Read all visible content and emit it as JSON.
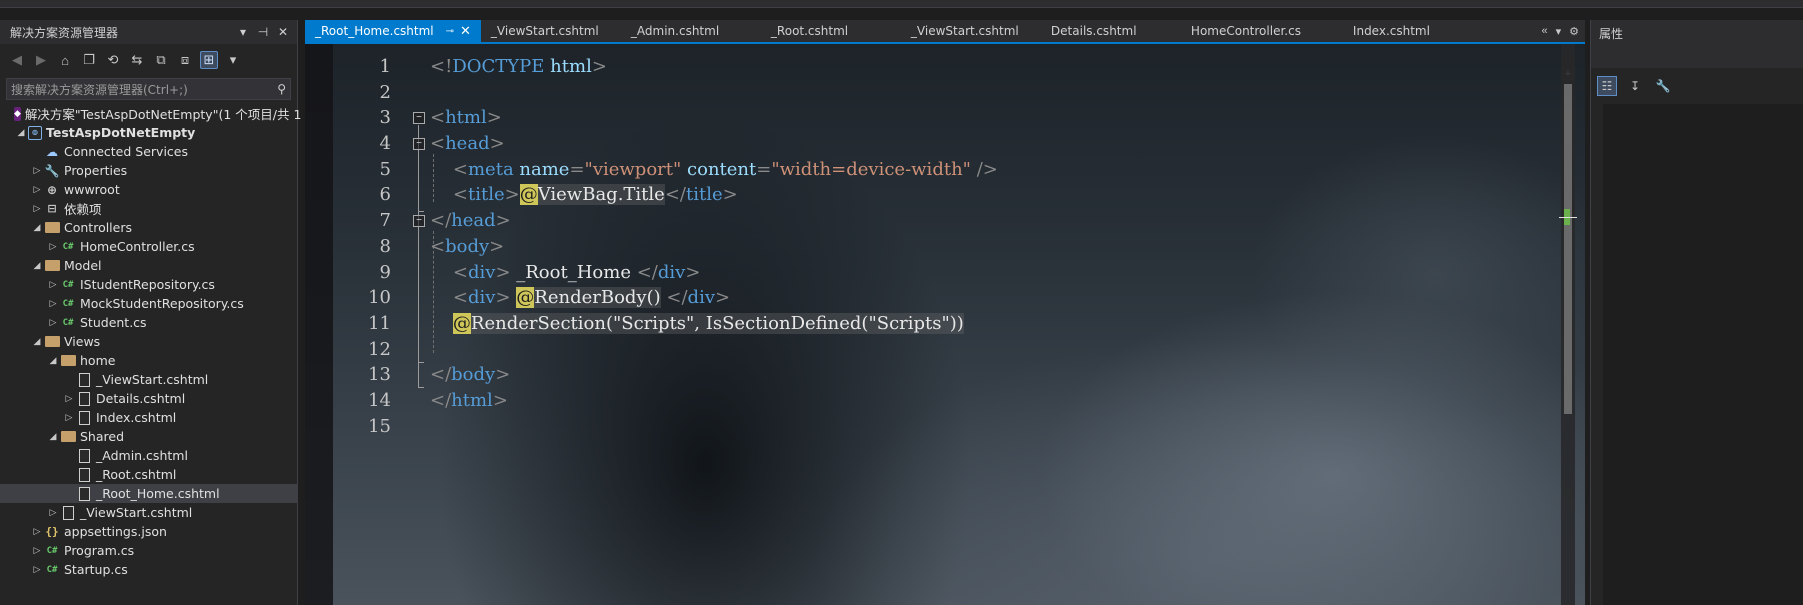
{
  "solution_explorer": {
    "title": "解决方案资源管理器",
    "title_buttons": [
      "▾",
      "⊣",
      "✕"
    ],
    "search_placeholder": "搜索解决方案资源管理器(Ctrl+;)",
    "tree": [
      {
        "label": "解决方案\"TestAspDotNetEmpty\"(1 个项目/共 1",
        "icon": "solution-icon",
        "depth": 0,
        "expand": "none",
        "bold": false
      },
      {
        "label": "TestAspDotNetEmpty",
        "icon": "project-icon",
        "depth": 0,
        "expand": "open",
        "bold": true
      },
      {
        "label": "Connected Services",
        "icon": "connected-services-icon",
        "depth": 1,
        "expand": "none"
      },
      {
        "label": "Properties",
        "icon": "properties-icon",
        "depth": 1,
        "expand": "closed"
      },
      {
        "label": "wwwroot",
        "icon": "globe-icon",
        "depth": 1,
        "expand": "closed"
      },
      {
        "label": "依赖项",
        "icon": "dependencies-icon",
        "depth": 1,
        "expand": "closed"
      },
      {
        "label": "Controllers",
        "icon": "folder-icon",
        "depth": 1,
        "expand": "open"
      },
      {
        "label": "HomeController.cs",
        "icon": "csharp-file-icon",
        "depth": 2,
        "expand": "closed"
      },
      {
        "label": "Model",
        "icon": "folder-icon",
        "depth": 1,
        "expand": "open"
      },
      {
        "label": "IStudentRepository.cs",
        "icon": "csharp-file-icon",
        "depth": 2,
        "expand": "closed"
      },
      {
        "label": "MockStudentRepository.cs",
        "icon": "csharp-file-icon",
        "depth": 2,
        "expand": "closed"
      },
      {
        "label": "Student.cs",
        "icon": "csharp-file-icon",
        "depth": 2,
        "expand": "closed"
      },
      {
        "label": "Views",
        "icon": "folder-icon",
        "depth": 1,
        "expand": "open"
      },
      {
        "label": "home",
        "icon": "folder-icon",
        "depth": 2,
        "expand": "open"
      },
      {
        "label": "_ViewStart.cshtml",
        "icon": "cshtml-file-icon",
        "depth": 3,
        "expand": "none"
      },
      {
        "label": "Details.cshtml",
        "icon": "cshtml-file-icon",
        "depth": 3,
        "expand": "closed"
      },
      {
        "label": "Index.cshtml",
        "icon": "cshtml-file-icon",
        "depth": 3,
        "expand": "closed"
      },
      {
        "label": "Shared",
        "icon": "folder-icon",
        "depth": 2,
        "expand": "open"
      },
      {
        "label": "_Admin.cshtml",
        "icon": "cshtml-file-icon",
        "depth": 3,
        "expand": "none"
      },
      {
        "label": "_Root.cshtml",
        "icon": "cshtml-file-icon",
        "depth": 3,
        "expand": "none"
      },
      {
        "label": "_Root_Home.cshtml",
        "icon": "cshtml-file-icon",
        "depth": 3,
        "expand": "none",
        "selected": true
      },
      {
        "label": "_ViewStart.cshtml",
        "icon": "cshtml-file-icon",
        "depth": 2,
        "expand": "closed"
      },
      {
        "label": "appsettings.json",
        "icon": "json-file-icon",
        "depth": 1,
        "expand": "closed"
      },
      {
        "label": "Program.cs",
        "icon": "csharp-file-icon",
        "depth": 1,
        "expand": "closed"
      },
      {
        "label": "Startup.cs",
        "icon": "csharp-file-icon",
        "depth": 1,
        "expand": "closed"
      }
    ]
  },
  "editor": {
    "tabs": [
      {
        "label": "_Root_Home.cshtml",
        "active": true
      },
      {
        "label": "_ViewStart.cshtml",
        "active": false
      },
      {
        "label": "_Admin.cshtml",
        "active": false
      },
      {
        "label": "_Root.cshtml",
        "active": false
      },
      {
        "label": "_ViewStart.cshtml",
        "active": false
      },
      {
        "label": "Details.cshtml",
        "active": false
      },
      {
        "label": "HomeController.cs",
        "active": false
      },
      {
        "label": "Index.cshtml",
        "active": false
      }
    ],
    "tab_pin_glyph": "⊸",
    "tab_close_glyph": "✕",
    "line_numbers": [
      "1",
      "2",
      "3",
      "4",
      "5",
      "6",
      "7",
      "8",
      "9",
      "10",
      "11",
      "12",
      "13",
      "14",
      "15"
    ],
    "code_lines": [
      [
        [
          "punc",
          "<!"
        ],
        [
          "tag",
          "DOCTYPE"
        ],
        [
          "text",
          " "
        ],
        [
          "attr",
          "html"
        ],
        [
          "punc",
          ">"
        ]
      ],
      [],
      [
        [
          "punc",
          "<"
        ],
        [
          "tag",
          "html"
        ],
        [
          "punc",
          ">"
        ]
      ],
      [
        [
          "punc",
          "<"
        ],
        [
          "tag",
          "head"
        ],
        [
          "punc",
          ">"
        ]
      ],
      [
        [
          "text",
          "    "
        ],
        [
          "punc",
          "<"
        ],
        [
          "tag",
          "meta"
        ],
        [
          "text",
          " "
        ],
        [
          "attr",
          "name"
        ],
        [
          "punc",
          "="
        ],
        [
          "str",
          "\"viewport\""
        ],
        [
          "text",
          " "
        ],
        [
          "attr",
          "content"
        ],
        [
          "punc",
          "="
        ],
        [
          "str",
          "\"width=device-width\""
        ],
        [
          "text",
          " "
        ],
        [
          "punc",
          "/>"
        ]
      ],
      [
        [
          "text",
          "    "
        ],
        [
          "punc",
          "<"
        ],
        [
          "tag",
          "title"
        ],
        [
          "punc",
          ">"
        ],
        [
          "razor",
          "@"
        ],
        [
          "hl",
          "ViewBag.Title"
        ],
        [
          "punc",
          "</"
        ],
        [
          "tag",
          "title"
        ],
        [
          "punc",
          ">"
        ]
      ],
      [
        [
          "punc",
          "</"
        ],
        [
          "tag",
          "head"
        ],
        [
          "punc",
          ">"
        ]
      ],
      [
        [
          "punc",
          "<"
        ],
        [
          "tag",
          "body"
        ],
        [
          "punc",
          ">"
        ]
      ],
      [
        [
          "text",
          "    "
        ],
        [
          "punc",
          "<"
        ],
        [
          "tag",
          "div"
        ],
        [
          "punc",
          ">"
        ],
        [
          "text",
          " _Root_Home "
        ],
        [
          "punc",
          "</"
        ],
        [
          "tag",
          "div"
        ],
        [
          "punc",
          ">"
        ]
      ],
      [
        [
          "text",
          "    "
        ],
        [
          "punc",
          "<"
        ],
        [
          "tag",
          "div"
        ],
        [
          "punc",
          ">"
        ],
        [
          "text",
          " "
        ],
        [
          "razor",
          "@"
        ],
        [
          "hl",
          "RenderBody()"
        ],
        [
          "text",
          " "
        ],
        [
          "punc",
          "</"
        ],
        [
          "tag",
          "div"
        ],
        [
          "punc",
          ">"
        ]
      ],
      [
        [
          "text",
          "    "
        ],
        [
          "razor",
          "@"
        ],
        [
          "hl",
          "RenderSection(\"Scripts\", IsSectionDefined(\"Scripts\"))"
        ]
      ],
      [],
      [
        [
          "punc",
          "</"
        ],
        [
          "tag",
          "body"
        ],
        [
          "punc",
          ">"
        ]
      ],
      [
        [
          "punc",
          "</"
        ],
        [
          "tag",
          "html"
        ],
        [
          "punc",
          ">"
        ]
      ],
      []
    ]
  },
  "properties": {
    "title": "属性"
  },
  "colors": {
    "accent": "#007acc",
    "tag": "#569cd6",
    "attribute": "#9cdcfe",
    "string": "#ce9178",
    "razor_marker": "#cfc65a"
  }
}
